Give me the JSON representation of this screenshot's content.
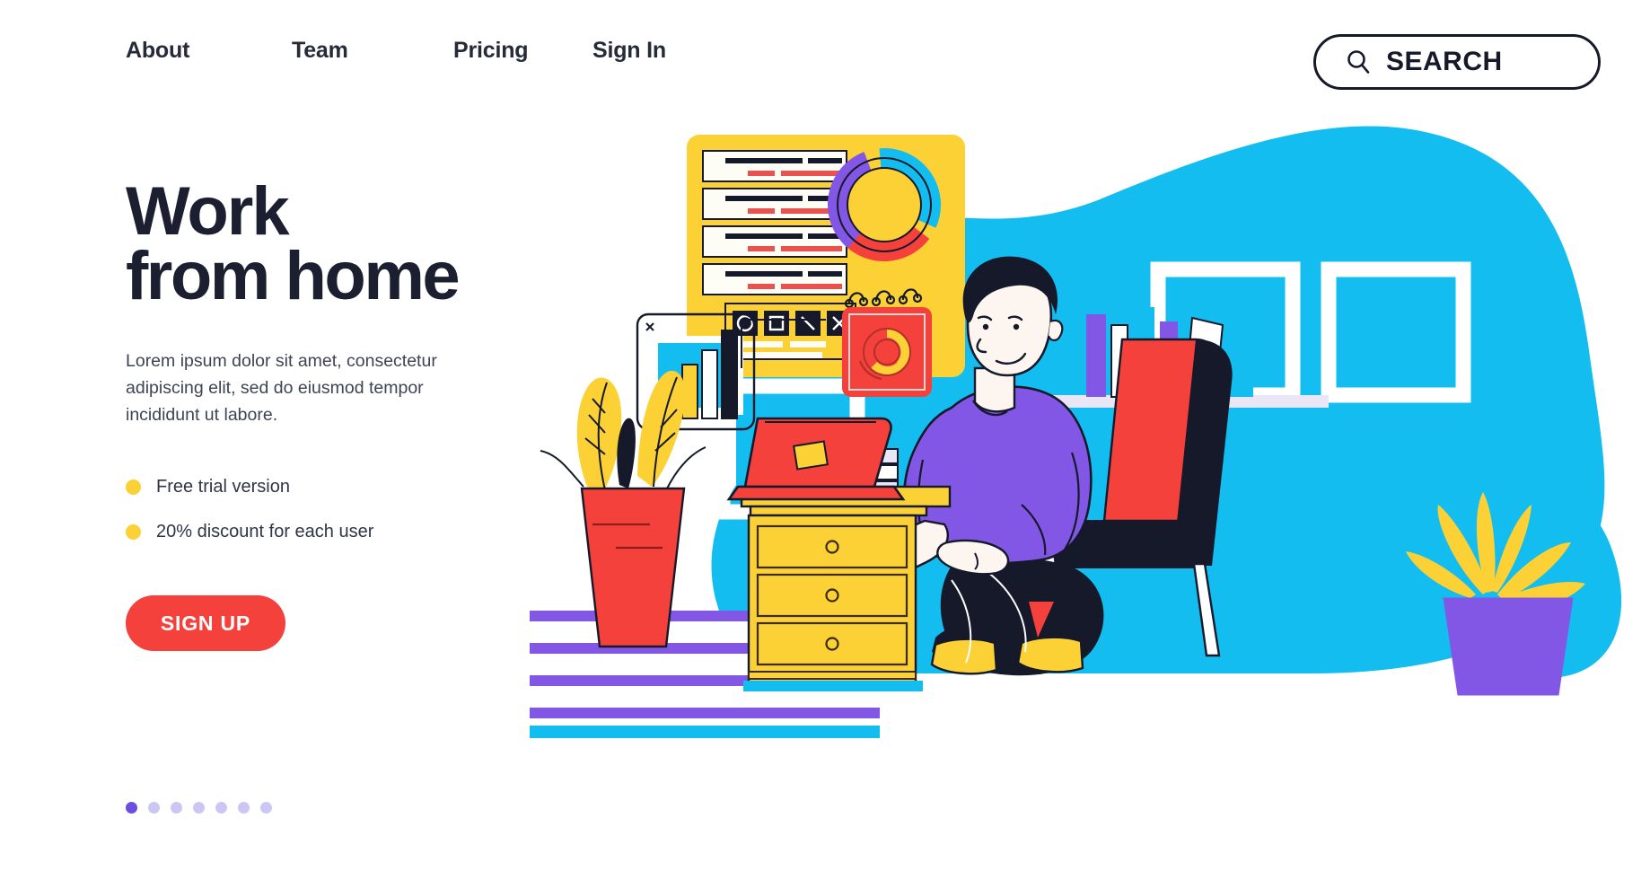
{
  "header": {
    "nav": [
      {
        "label": "About"
      },
      {
        "label": "Team"
      },
      {
        "label": "Pricing"
      },
      {
        "label": "Sign In"
      }
    ],
    "search": {
      "label": "SEARCH",
      "icon": "search-icon"
    }
  },
  "hero": {
    "title_line1": "Work",
    "title_line2": "from home",
    "paragraph": "Lorem ipsum dolor sit amet, consectetur adipiscing elit, sed do eiusmod tempor incididunt ut labore.",
    "features": [
      {
        "label": "Free trial version"
      },
      {
        "label": "20% discount for each user"
      }
    ],
    "cta_label": "SIGN UP"
  },
  "carousel": {
    "total": 7,
    "active_index": 0
  },
  "colors": {
    "red": "#f4413c",
    "yellow": "#fbd136",
    "cyan": "#14bdf0",
    "purple": "#8257e6",
    "dark": "#16192a",
    "white": "#ffffff",
    "light_lavender": "#ccc6f5",
    "accent_purple": "#6c4fe0",
    "skin": "#fdf6f0"
  },
  "illustration": {
    "name": "work-from-home-illustration",
    "elements": [
      "background-blob",
      "window-frames",
      "radiator",
      "dashboard-panel",
      "bar-chart-card",
      "calendar-chart-card",
      "bookshelf",
      "potted-plant-left",
      "potted-plant-right",
      "desk-drawers",
      "laptop",
      "person",
      "armchair"
    ],
    "dashboard": {
      "rows": 4,
      "toolbar_icons": [
        "circle-icon",
        "square-icon",
        "line-icon",
        "close-icon"
      ],
      "donut_segments": [
        "cyan",
        "red",
        "purple"
      ]
    },
    "bar_chart": {
      "bars": [
        "red",
        "yellow",
        "white",
        "black"
      ],
      "close_icon": "close-icon"
    },
    "drawers": {
      "count": 3,
      "knob": "round-knob"
    }
  }
}
